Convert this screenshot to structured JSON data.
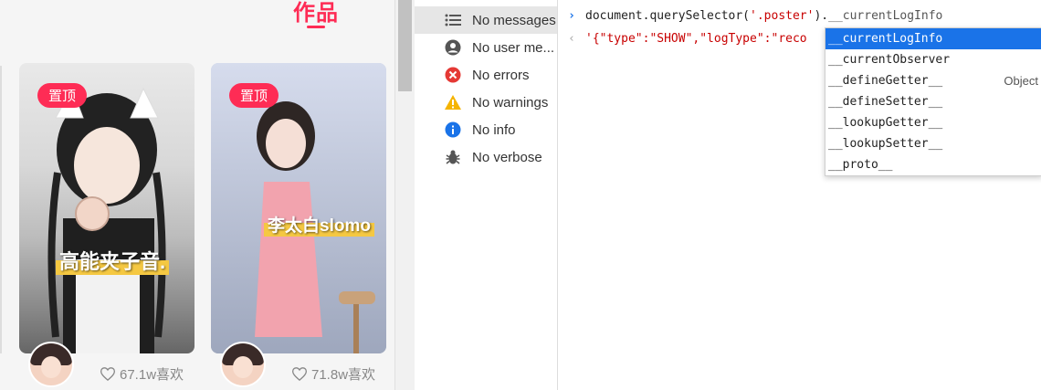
{
  "left_panel": {
    "section_title": "作品",
    "cards": [
      {
        "pin_label": "置顶",
        "caption": "高能夹子音.",
        "likes": "67.1w喜欢"
      },
      {
        "pin_label": "置顶",
        "caption": "李太白slomo",
        "likes": "71.8w喜欢"
      }
    ]
  },
  "sidebar": {
    "items": [
      {
        "label": "No messages",
        "icon": "list-icon"
      },
      {
        "label": "No user me...",
        "icon": "user-icon"
      },
      {
        "label": "No errors",
        "icon": "error-icon"
      },
      {
        "label": "No warnings",
        "icon": "warning-icon"
      },
      {
        "label": "No info",
        "icon": "info-icon"
      },
      {
        "label": "No verbose",
        "icon": "bug-icon"
      }
    ]
  },
  "console": {
    "input_prefix": "document.querySelector(",
    "input_string": "'.poster'",
    "input_suffix": ").",
    "input_ghost": "__currentLogInfo",
    "result_text": "'{\"type\":\"SHOW\",\"logType\":\"reco"
  },
  "autocomplete": {
    "items": [
      {
        "label": "__currentLogInfo",
        "type": ""
      },
      {
        "label": "__currentObserver",
        "type": ""
      },
      {
        "label": "__defineGetter__",
        "type": "Object"
      },
      {
        "label": "__defineSetter__",
        "type": ""
      },
      {
        "label": "__lookupGetter__",
        "type": ""
      },
      {
        "label": "__lookupSetter__",
        "type": ""
      },
      {
        "label": "__proto__",
        "type": ""
      }
    ]
  },
  "colors": {
    "accent": "#fe2c55",
    "selection": "#1a73e8",
    "string": "#c80000",
    "error": "#e53935",
    "warning": "#f5b400",
    "info": "#1a73e8"
  }
}
